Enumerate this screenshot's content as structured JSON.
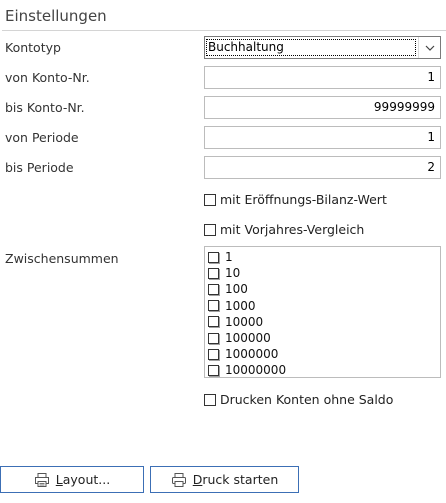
{
  "section": {
    "title": "Einstellungen"
  },
  "form": {
    "kontotyp": {
      "label": "Kontotyp",
      "value": "Buchhaltung"
    },
    "von_konto": {
      "label": "von Konto-Nr.",
      "value": "1"
    },
    "bis_konto": {
      "label": "bis Konto-Nr.",
      "value": "99999999"
    },
    "von_periode": {
      "label": "von Periode",
      "value": "1"
    },
    "bis_periode": {
      "label": "bis Periode",
      "value": "2"
    },
    "eroeffnung": {
      "label": "mit Eröffnungs-Bilanz-Wert",
      "checked": false
    },
    "vorjahr": {
      "label": "mit Vorjahres-Vergleich",
      "checked": false
    },
    "zwischensummen": {
      "label": "Zwischensummen",
      "options": [
        "1",
        "10",
        "100",
        "1000",
        "10000",
        "100000",
        "1000000",
        "10000000"
      ]
    },
    "ohne_saldo": {
      "label": "Drucken Konten ohne Saldo",
      "checked": false
    }
  },
  "buttons": {
    "layout": {
      "label_accel": "L",
      "label_rest": "ayout...",
      "icon": "layout-icon"
    },
    "druck": {
      "label_accel": "D",
      "label_rest": "ruck starten",
      "icon": "printer-icon"
    }
  },
  "colors": {
    "button_border": "#3c6fb5",
    "field_border": "#bcbcbc",
    "combo_border": "#7a7a7a"
  }
}
